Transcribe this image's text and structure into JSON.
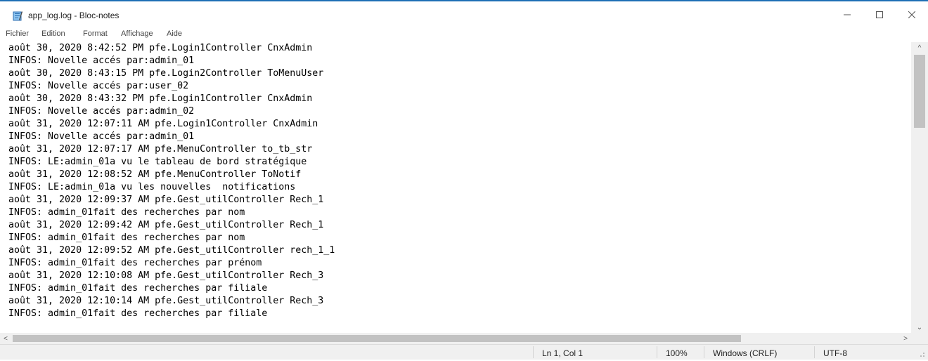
{
  "window": {
    "title": "app_log.log - Bloc-notes",
    "icon": "notepad-icon",
    "controls": {
      "minimize": "—",
      "maximize": "☐",
      "close": "✕"
    }
  },
  "menu": [
    "Fichier",
    "Edition",
    "Format",
    "Affichage",
    "Aide"
  ],
  "editor": {
    "lines": [
      "août 30, 2020 8:42:52 PM pfe.Login1Controller CnxAdmin",
      "INFOS: Novelle accés par:admin_01",
      "août 30, 2020 8:43:15 PM pfe.Login2Controller ToMenuUser",
      "INFOS: Novelle accés par:user_02",
      "août 30, 2020 8:43:32 PM pfe.Login1Controller CnxAdmin",
      "INFOS: Novelle accés par:admin_02",
      "août 31, 2020 12:07:11 AM pfe.Login1Controller CnxAdmin",
      "INFOS: Novelle accés par:admin_01",
      "août 31, 2020 12:07:17 AM pfe.MenuController to_tb_str",
      "INFOS: LE:admin_01a vu le tableau de bord stratégique",
      "août 31, 2020 12:08:52 AM pfe.MenuController ToNotif",
      "INFOS: LE:admin_01a vu les nouvelles  notifications",
      "août 31, 2020 12:09:37 AM pfe.Gest_utilController Rech_1",
      "INFOS: admin_01fait des recherches par nom",
      "août 31, 2020 12:09:42 AM pfe.Gest_utilController Rech_1",
      "INFOS: admin_01fait des recherches par nom",
      "août 31, 2020 12:09:52 AM pfe.Gest_utilController rech_1_1",
      "INFOS: admin_01fait des recherches par prénom",
      "août 31, 2020 12:10:08 AM pfe.Gest_utilController Rech_3",
      "INFOS: admin_01fait des recherches par filiale",
      "août 31, 2020 12:10:14 AM pfe.Gest_utilController Rech_3",
      "INFOS: admin_01fait des recherches par filiale"
    ]
  },
  "scrollbars": {
    "up": "^",
    "down": "⌄",
    "left": "<",
    "right": ">"
  },
  "status": {
    "position": "Ln 1, Col 1",
    "zoom": "100%",
    "line_ending": "Windows (CRLF)",
    "encoding": "UTF-8"
  },
  "colors": {
    "accent": "#1f6fb5",
    "chrome": "#f0f0f0",
    "thumb": "#c2c2c2"
  }
}
